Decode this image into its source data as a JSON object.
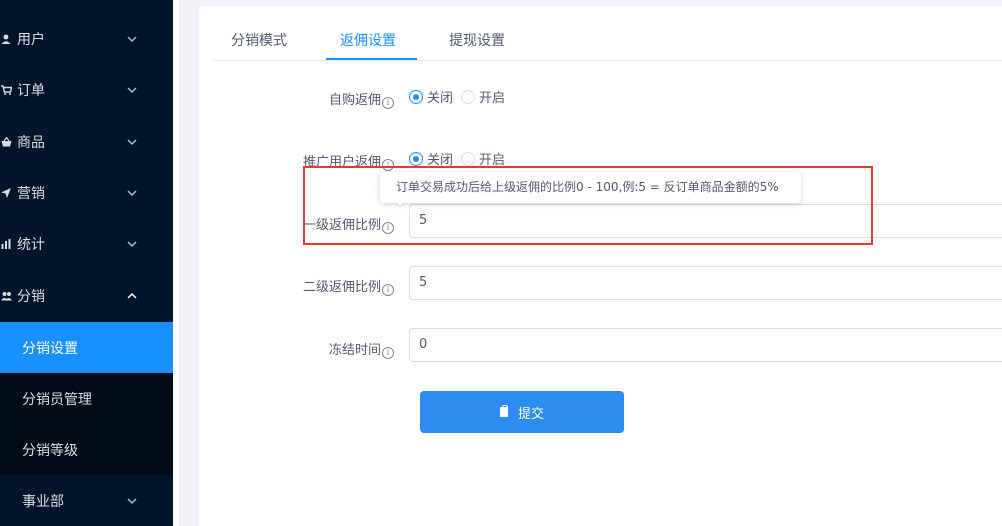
{
  "sidebar": {
    "menu": [
      {
        "label": "用户",
        "icon": "user-icon",
        "arrow": "down"
      },
      {
        "label": "订单",
        "icon": "cart-icon",
        "arrow": "down"
      },
      {
        "label": "商品",
        "icon": "basket-icon",
        "arrow": "down"
      },
      {
        "label": "营销",
        "icon": "send-icon",
        "arrow": "down"
      },
      {
        "label": "统计",
        "icon": "chart-icon",
        "arrow": "down"
      },
      {
        "label": "分销",
        "icon": "people-icon",
        "arrow": "up"
      }
    ],
    "submenu": [
      {
        "label": "分销设置",
        "active": true
      },
      {
        "label": "分销员管理",
        "active": false
      },
      {
        "label": "分销等级",
        "active": false
      }
    ],
    "last_menu": {
      "label": "事业部",
      "arrow": "down"
    }
  },
  "tabs": [
    {
      "label": "分销模式",
      "active": false
    },
    {
      "label": "返佣设置",
      "active": true
    },
    {
      "label": "提现设置",
      "active": false
    }
  ],
  "form": {
    "self_rebate": {
      "label": "自购返佣",
      "options": [
        "关闭",
        "开启"
      ],
      "selected": "关闭"
    },
    "promo_rebate": {
      "label": "推广用户返佣",
      "options": [
        "关闭",
        "开启"
      ],
      "selected": "关闭"
    },
    "level1_ratio": {
      "label": "一级返佣比例",
      "value": "5"
    },
    "level2_ratio": {
      "label": "二级返佣比例",
      "value": "5"
    },
    "freeze_time": {
      "label": "冻结时间",
      "value": "0"
    },
    "submit_label": "提交"
  },
  "tooltip": {
    "text": "订单交易成功后给上级返佣的比例0 - 100,例:5 = 反订单商品金额的5%"
  },
  "info_glyph": "i",
  "colors": {
    "sidebar_bg": "#001529",
    "active_blue": "#1890ff",
    "button_blue": "#2d8cf0",
    "highlight_red": "#e53935"
  }
}
